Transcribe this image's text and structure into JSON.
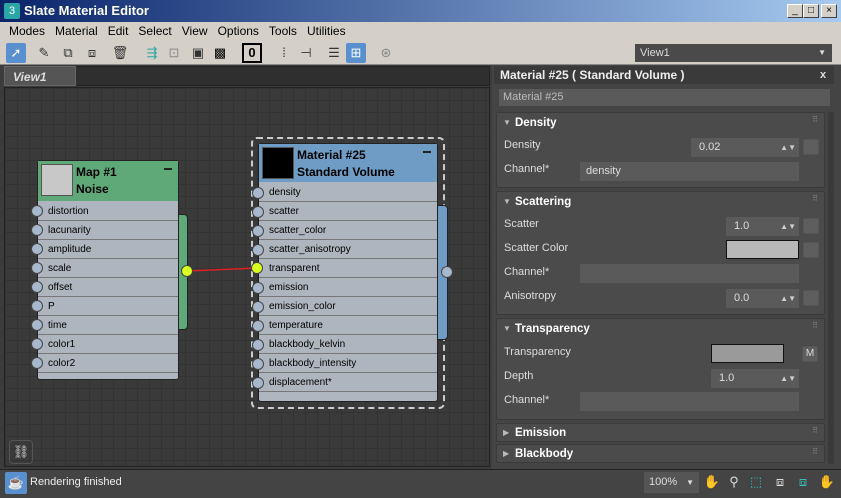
{
  "window": {
    "title": "Slate Material Editor",
    "app_icon": "3"
  },
  "menu": [
    "Modes",
    "Material",
    "Edit",
    "Select",
    "View",
    "Options",
    "Tools",
    "Utilities"
  ],
  "toolbar": {
    "icons": [
      "select-tool",
      "pick-material",
      "put-to-scene",
      "assign-to-selection",
      "delete",
      "move-children",
      "lay-out-all",
      "background",
      "checker",
      "material-id",
      "lay-out-children",
      "hide-unused-slots",
      "show-map-in-viewport",
      "parameter-editor",
      "select-by-material"
    ],
    "material_id": "0"
  },
  "view_selector": {
    "value": "View1"
  },
  "tabs": [
    {
      "label": "View1"
    }
  ],
  "nodes": {
    "map": {
      "title": "Map #1",
      "subtitle": "Noise",
      "color": "#5fa878",
      "slots": [
        "distortion",
        "lacunarity",
        "amplitude",
        "scale",
        "offset",
        "P",
        "time",
        "color1",
        "color2"
      ]
    },
    "material": {
      "title": "Material #25",
      "subtitle": "Standard Volume",
      "color": "#6e9cc4",
      "slots": [
        "density",
        "scatter",
        "scatter_color",
        "scatter_anisotropy",
        "transparent",
        "emission",
        "emission_color",
        "temperature",
        "blackbody_kelvin",
        "blackbody_intensity",
        "displacement*"
      ]
    }
  },
  "panel": {
    "title": "Material #25  ( Standard Volume )",
    "close": "x",
    "name": "Material #25",
    "density": {
      "header": "Density",
      "density_label": "Density",
      "density_value": "0.02",
      "channel_label": "Channel*",
      "channel_value": "density"
    },
    "scattering": {
      "header": "Scattering",
      "scatter_label": "Scatter",
      "scatter_value": "1.0",
      "color_label": "Scatter Color",
      "scatter_color": "#b8b8b8",
      "channel_label": "Channel*",
      "channel_value": "",
      "aniso_label": "Anisotropy",
      "aniso_value": "0.0"
    },
    "transparency": {
      "header": "Transparency",
      "transparency_label": "Transparency",
      "transparency_color": "#9a9a9a",
      "map_btn": "M",
      "depth_label": "Depth",
      "depth_value": "1.0",
      "channel_label": "Channel*",
      "channel_value": ""
    },
    "emission": {
      "header": "Emission"
    },
    "blackbody": {
      "header": "Blackbody"
    }
  },
  "status": {
    "text": "Rendering finished",
    "zoom": "100%"
  }
}
